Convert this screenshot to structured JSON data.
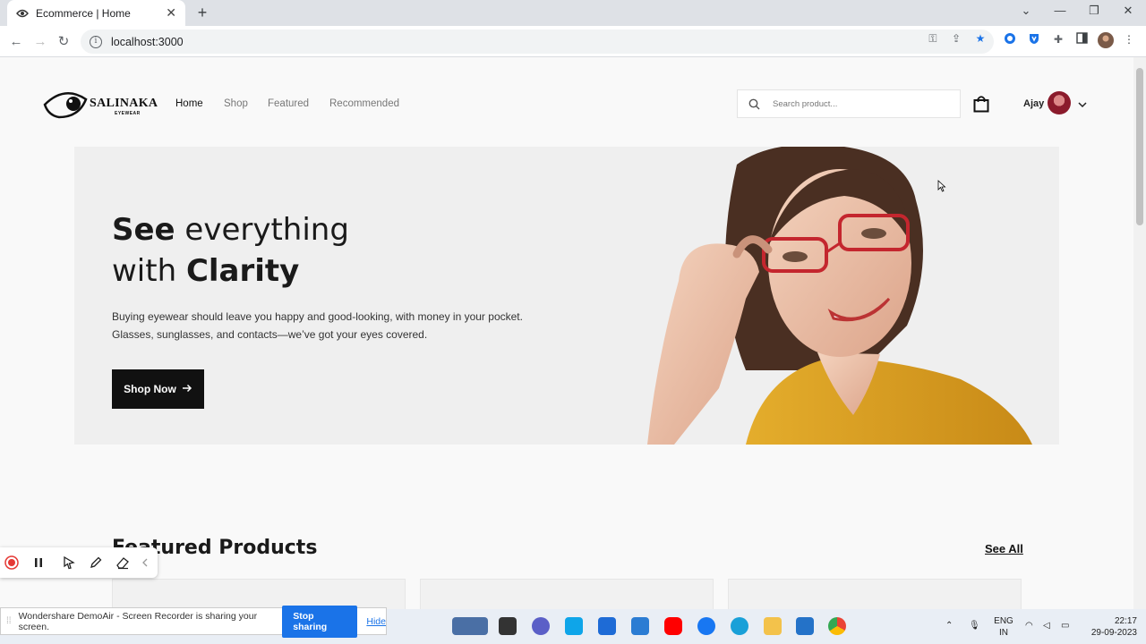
{
  "browser": {
    "tab_title": "Ecommerce | Home",
    "tab_close": "✕",
    "new_tab": "+",
    "url": "localhost:3000"
  },
  "site": {
    "logo_name": "SALINAKA",
    "logo_sub": "EYEWEAR",
    "nav": [
      "Home",
      "Shop",
      "Featured",
      "Recommended"
    ],
    "search_placeholder": "Search product...",
    "user_name": "Ajay"
  },
  "hero": {
    "title_bold_1": "See",
    "title_rest_1": " everything",
    "title_rest_2": "with ",
    "title_bold_2": "Clarity",
    "description": "Buying eyewear should leave you happy and good-looking, with money in your pocket. Glasses, sunglasses, and contacts—we’ve got your eyes covered.",
    "button_label": "Shop Now"
  },
  "featured": {
    "title": "Featured Products",
    "see_all": "See All"
  },
  "screen_share": {
    "message": "Wondershare DemoAir - Screen Recorder is sharing your screen.",
    "stop_label": "Stop sharing",
    "hide_label": "Hide"
  },
  "taskbar": {
    "lang_1": "ENG",
    "lang_2": "IN",
    "time": "22:17",
    "date": "29-09-2023"
  },
  "colors": {
    "accent": "#1a73e8",
    "button_dark": "#111111",
    "hero_bg": "#efefef"
  }
}
